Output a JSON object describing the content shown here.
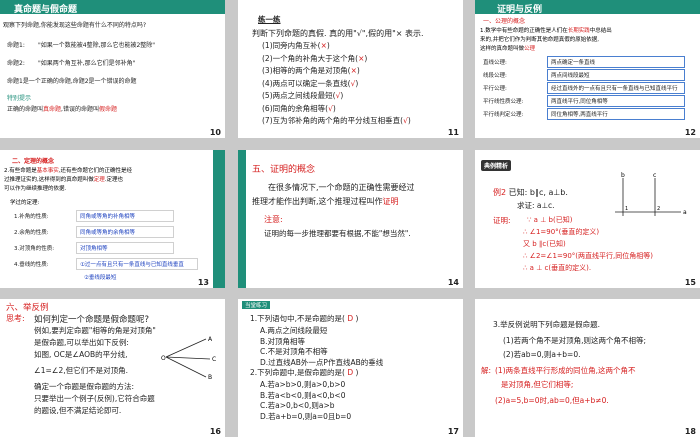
{
  "s1": {
    "title": "真命题与假命题",
    "q": "观察下列命题,你能发现这些命题有什么不同的特点吗?",
    "p1a": "命题1:",
    "p1b": "\"如果一个数能被4整除,那么它也能被2整除\"",
    "p2a": "命题2:",
    "p2b": "\"如果两个角互补,那么它们是邻补角\"",
    "red1": "命题1是一个正确的命题,命题2是一个错误的命题",
    "teal": "特别提示",
    "def_a": "正确的命题叫",
    "def_b": "真命题",
    ",": ",",
    "def_c": "错误的命题叫",
    "def_d": "假命题",
    "num": "10"
  },
  "s2": {
    "tag": "练一练",
    "q": "判断下列命题的真假. 真的用\"√\",假的用\"× 表示.",
    "items": [
      {
        "t": "(1)同旁内角互补(",
        "m": "×",
        "e": ")"
      },
      {
        "t": "(2)一个角的补角大于这个角(",
        "m": "×",
        "e": ")"
      },
      {
        "t": "(3)相等的两个角是对顶角(",
        "m": "×",
        "e": ")"
      },
      {
        "t": "(4)两点可以确定一条直线(",
        "m": "√",
        "e": ")"
      },
      {
        "t": "(5)两点之间线段最短(",
        "m": "√",
        "e": ")"
      },
      {
        "t": "(6)同角的余角相等(",
        "m": "√",
        "e": ")"
      },
      {
        "t": "(7)互为邻补角的两个角的平分线互相垂直(",
        "m": "√",
        "e": ")"
      }
    ],
    "num": "11"
  },
  "s3": {
    "title": "证明与反例",
    "sub": "一、公理的概念",
    "d1": "1.数学中有些命题的正确性是人们在",
    "d1r": "长期实践",
    "d1c": "中总结出",
    "d2": "来的,并把它们作为判断其他命题真假的原始依据,",
    "d3": "这样的真命题叫做",
    "d3r": "公理",
    "rows": [
      {
        "k": "直线公理:",
        "v": "两点确定一条直线"
      },
      {
        "k": "线段公理:",
        "v": "两点间线段最短"
      },
      {
        "k": "平行公理:",
        "v": "经过直线外的一点有且只有一条直线与已知直线平行"
      },
      {
        "k": "平行线性质公理:",
        "v": "两直线平行,同位角相等"
      },
      {
        "k": "平行线判定公理:",
        "v": "同位角相等,两直线平行"
      }
    ],
    "num": "12"
  },
  "s4": {
    "title": "二、定理的概念",
    "l1": "2.有些命题是",
    "l1r": "基本事实",
    "l1c": ",还有些命题它们的正确性是经",
    "l2": "过推理证实的,这样得到的真命题叫做",
    "l2r": "定理",
    "l2c": ".定理也",
    "l3": "可以作为继续推理的依据.",
    "l4": "学过的定理:",
    "rows": [
      {
        "k": "1.补角的性质:",
        "v": "同角或等角的补角相等"
      },
      {
        "k": "2.余角的性质:",
        "v": "同角或等角的余角相等"
      },
      {
        "k": "3.对顶角的性质:",
        "v": "对顶角相等"
      },
      {
        "k": "4.垂线的性质:",
        "v": "①过一点有且只有一条直线与已知直线垂直"
      }
    ],
    "extra": "②垂线段最短",
    "num": "13"
  },
  "s5": {
    "title": "五、证明的概念",
    "l1": "在很多情况下,一个命题的正确性需要经过",
    "l2": "推理才能作出判断,这个推理过程叫作",
    "l2r": "证明",
    ".": ".",
    "note": "注意:",
    "l3": "证明的每一步推理都要有根据,不能\"想当然\".",
    "num": "14"
  },
  "s6": {
    "badge": "典例精析",
    "ex": "例2",
    "ex_t": "已知: b∥c, a⊥b.",
    "ask": "求证: a⊥c.",
    "proof": "证明:",
    "p1": "∵ a ⊥ b(已知)",
    "p2": "∴ ∠1=90°(垂直的定义)",
    "p3": "又 b ∥c(已知)",
    "p4": "∴ ∠2=∠1=90°(两直线平行,同位角相等)",
    "p5": "∴ a ⊥ c(垂直的定义).",
    "lab_a": "a",
    "lab_b": "b",
    "lab_c": "c",
    "lab_1": "1",
    "lab_2": "2",
    "num": "15"
  },
  "s7": {
    "title": "六、举反例",
    "think": "思考:",
    "l1": "如何判定一个命题是假命题呢?",
    "l2": "例如,要判定命题\"相等的角是对顶角\"",
    "l3a": "是假命题,",
    "l3b": "可以举出如下反例:",
    "l4": "如图, OC是∠AOB的平分线,",
    "l5": "∠1=∠2,但它们不是对顶角.",
    "l6": "确定一个命题是假命题的方法:",
    "l7": "只要举出一个例子(反例),它符合命题",
    "l8": "的题设,但不满足结论即可.",
    "lab_a": "A",
    "lab_b": "B",
    "lab_c": "C",
    "lab_o": "O",
    "num": "16"
  },
  "s8": {
    "tag": "当堂练习",
    "q1": "1.下列语句中,不是命题的是(",
    "a1": "D",
    ")": ")",
    "o1": [
      "A.两点之间线段最短",
      "B.对顶角相等",
      "C.不是对顶角不相等",
      "D.过直线AB外一点P作直线AB的垂线"
    ],
    "q2": "2.下列命题中,是假命题的是(",
    "a2": "D",
    "o2": [
      "A.若a>b>0,则a>0,b>0",
      "B.若a<b<0,则a<0,b<0",
      "C.若a>0,b<0,则a>b",
      "D.若a+b=0,则a=0且b=0"
    ],
    "num": "17"
  },
  "s9": {
    "q": "3.举反例说明下列命题是假命题.",
    "q1": "(1)若两个角不是对顶角,则这两个角不相等;",
    "q2": "(2)若ab=0,则a+b=0.",
    "ans": "解:",
    "a1": "(1)两条直线平行形成的同位角,这两个角不",
    "a2": "是对顶角,但它们相等;",
    "a3": "(2)a=5,b=0时,ab=0,但a+b≠0.",
    "num": "18"
  }
}
